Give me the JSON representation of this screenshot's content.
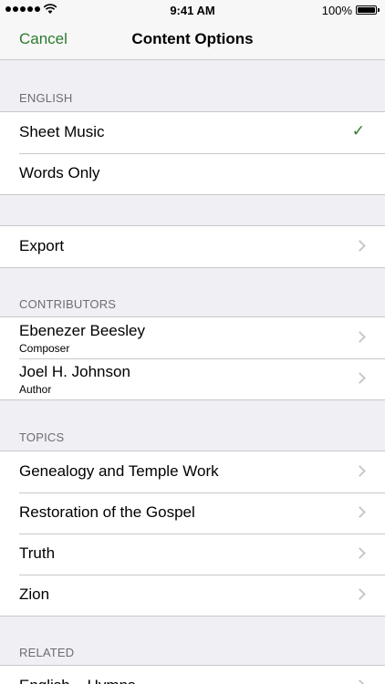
{
  "status": {
    "time": "9:41 AM",
    "battery": "100%"
  },
  "nav": {
    "cancel": "Cancel",
    "title": "Content Options"
  },
  "english": {
    "header": "ENGLISH",
    "options": [
      {
        "label": "Sheet Music",
        "selected": true
      },
      {
        "label": "Words Only",
        "selected": false
      }
    ]
  },
  "export": {
    "label": "Export"
  },
  "contributors": {
    "header": "CONTRIBUTORS",
    "items": [
      {
        "name": "Ebenezer Beesley",
        "role": "Composer"
      },
      {
        "name": "Joel H. Johnson",
        "role": "Author"
      }
    ]
  },
  "topics": {
    "header": "TOPICS",
    "items": [
      "Genealogy and Temple Work",
      "Restoration of the Gospel",
      "Truth",
      "Zion"
    ]
  },
  "related": {
    "header": "RELATED",
    "items": [
      "English – Hymns"
    ]
  },
  "colors": {
    "accent": "#2c7a2f",
    "background": "#efeff4"
  },
  "icons": {
    "check": "checkmark-icon",
    "chevron": "chevron-right-icon"
  }
}
